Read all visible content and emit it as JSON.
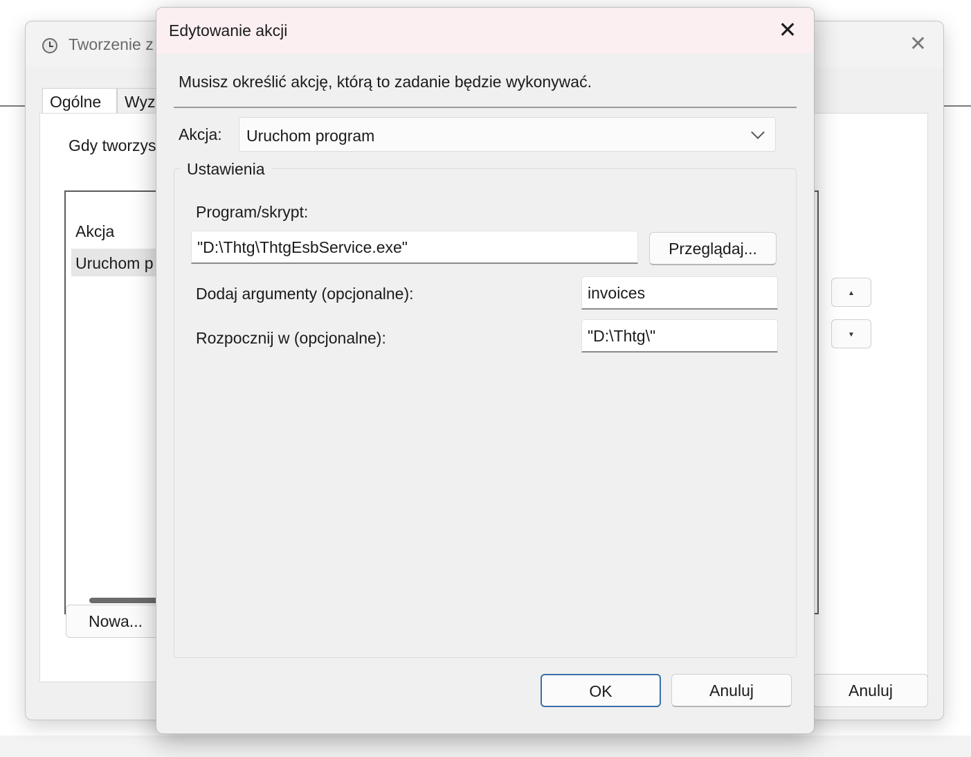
{
  "background_window": {
    "title": "Tworzenie z",
    "tabs": [
      "Ogólne",
      "Wyz"
    ],
    "description": "Gdy tworzys",
    "list_header": "Akcja",
    "list_row": "Uruchom p",
    "new_button": "Nowa...",
    "cancel_button": "Anuluj",
    "up_arrow": "▲",
    "down_arrow": "▼"
  },
  "dialog": {
    "title": "Edytowanie akcji",
    "close_glyph": "✕",
    "instruction": "Musisz określić akcję, którą to zadanie będzie wykonywać.",
    "action_label": "Akcja:",
    "action_value": "Uruchom program",
    "settings_title": "Ustawienia",
    "program_label": "Program/skrypt:",
    "program_value": "\"D:\\Thtg\\ThtgEsbService.exe\"",
    "browse_button": "Przeglądaj...",
    "args_label": "Dodaj argumenty (opcjonalne):",
    "args_value": "invoices",
    "start_label": "Rozpocznij w (opcjonalne):",
    "start_value": "\"D:\\Thtg\\\"",
    "ok_button": "OK",
    "cancel_button": "Anuluj"
  },
  "colors": {
    "titlebar_tint": "#fbeff2",
    "ok_border": "#3a6fa8",
    "window_bg": "#f0f0f0"
  },
  "icons": {
    "background_window": "clock-icon",
    "dialog_close": "close-icon",
    "dropdown": "chevron-down-icon"
  }
}
